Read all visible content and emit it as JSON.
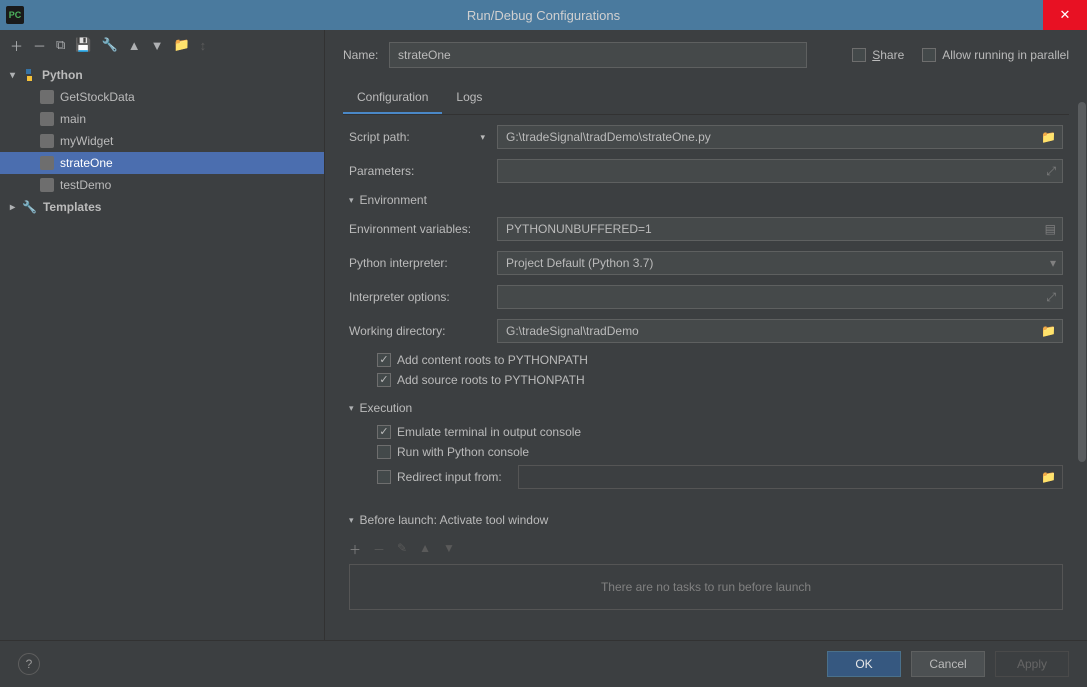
{
  "window": {
    "title": "Run/Debug Configurations"
  },
  "sidebar": {
    "python_label": "Python",
    "items": [
      {
        "label": "GetStockData"
      },
      {
        "label": "main"
      },
      {
        "label": "myWidget"
      },
      {
        "label": "strateOne"
      },
      {
        "label": "testDemo"
      }
    ],
    "templates_label": "Templates"
  },
  "header": {
    "name_label": "Name:",
    "name_value": "strateOne",
    "share_label": "Share",
    "allow_parallel_label": "Allow running in parallel"
  },
  "tabs": {
    "configuration": "Configuration",
    "logs": "Logs"
  },
  "form": {
    "script_path_label": "Script path:",
    "script_path_value": "G:\\tradeSignal\\tradDemo\\strateOne.py",
    "parameters_label": "Parameters:",
    "parameters_value": "",
    "environment_header": "Environment",
    "env_vars_label": "Environment variables:",
    "env_vars_value": "PYTHONUNBUFFERED=1",
    "interpreter_label": "Python interpreter:",
    "interpreter_value": "Project Default (Python 3.7)",
    "interp_options_label": "Interpreter options:",
    "interp_options_value": "",
    "workdir_label": "Working directory:",
    "workdir_value": "G:\\tradeSignal\\tradDemo",
    "add_content_roots": "Add content roots to PYTHONPATH",
    "add_source_roots": "Add source roots to PYTHONPATH",
    "execution_header": "Execution",
    "emulate_terminal": "Emulate terminal in output console",
    "run_python_console": "Run with Python console",
    "redirect_input_label": "Redirect input from:",
    "redirect_input_value": ""
  },
  "before_launch": {
    "header": "Before launch: Activate tool window",
    "empty": "There are no tasks to run before launch"
  },
  "footer": {
    "ok": "OK",
    "cancel": "Cancel",
    "apply": "Apply"
  }
}
